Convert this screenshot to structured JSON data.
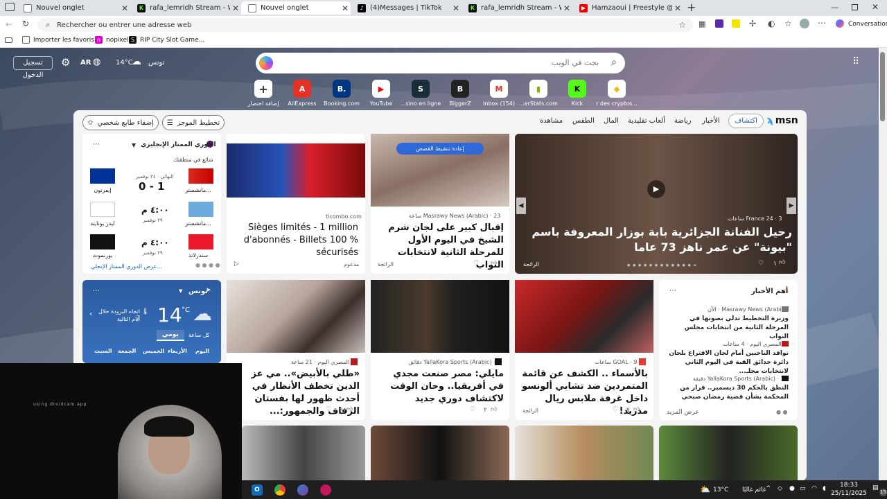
{
  "tabs": [
    {
      "title": "Nouvel onglet",
      "icon": "page-icon",
      "close": "✕"
    },
    {
      "title": "rafa_lemridh Stream - Watch Live",
      "icon": "kick-icon",
      "close": "✕"
    },
    {
      "title": "Nouvel onglet",
      "icon": "page-icon",
      "close": "✕"
    },
    {
      "title": "(4)Messages | TikTok",
      "icon": "tiktok-icon",
      "close": "✕"
    },
    {
      "title": "rafa_lemridh Stream - Watch Live",
      "icon": "kick-icon",
      "close": "✕"
    },
    {
      "title": "Hamzaoui | Freestyle @Rachma R",
      "icon": "youtube-icon",
      "close": "✕"
    }
  ],
  "new_tab": "+",
  "address": {
    "placeholder": "Rechercher ou entrer une adresse web"
  },
  "conversation": "Conversation",
  "favorites": [
    {
      "label": "Importer les favoris"
    },
    {
      "label": "nopixel"
    },
    {
      "label": "RIP City Slot Game..."
    }
  ],
  "msn_top": {
    "signin": "تسجيل الدخول",
    "lang": "AR",
    "temp": "14°C",
    "city": "تونس"
  },
  "search": {
    "placeholder": "بحث في الويب"
  },
  "shortcuts": [
    {
      "label": "إضافة اختصار",
      "glyph": "+"
    },
    {
      "label": "AliExpress",
      "glyph": "A"
    },
    {
      "label": "Booking.com",
      "glyph": "B."
    },
    {
      "label": "YouTube",
      "glyph": "▶"
    },
    {
      "label": "...sino en ligne",
      "glyph": "S"
    },
    {
      "label": "BiggerZ",
      "glyph": "B"
    },
    {
      "label": "Inbox (154)",
      "glyph": "M"
    },
    {
      "label": "...erStats.com",
      "glyph": "▮"
    },
    {
      "label": "Kick",
      "glyph": "K"
    },
    {
      "label": "r des cryptos...",
      "glyph": "◆"
    }
  ],
  "feed_nav": {
    "brand": "msn",
    "items": [
      "اكتشاف",
      "الأخبار",
      "رياضة",
      "ألعاب تقليدية",
      "المال",
      "الطقس",
      "مشاهدة"
    ],
    "personalize": "إضفاء طابع شخصي",
    "layout": "تخطيط الموجز"
  },
  "sports": {
    "league": "الدوري الممتاز الإنجليزي",
    "trending": "شائع في منطقتك",
    "matches": [
      {
        "home": "مانشستر...",
        "away": "إيفرتون",
        "score": "0 - 1",
        "status": "النهائي · ٢٤ نوفمبر"
      },
      {
        "home": "مانشستر...",
        "away": "ليدز يونايتد",
        "score": "٤:٠٠ م",
        "status": "٢٩ نوفمبر"
      },
      {
        "home": "سندرلاند",
        "away": "بورنموث",
        "score": "٤:٠٠ م",
        "status": "٢٩ نوفمبر"
      }
    ],
    "footer": "عرض الدوري الممتاز الإنجلي...",
    "more": "..."
  },
  "cards": {
    "ad": {
      "source": "ticombo.com",
      "title": "Sièges limités - 1 million d'abonnés - Billets 100 % sécurisés",
      "sponsored": "مدعوم"
    },
    "masrawy1": {
      "badge": "إعادة تنشيط القصص",
      "source": "Masrawy News (Arabic) · 23 ساعة",
      "title": "إقبال كبير على لجان شرم الشيخ في اليوم الأول للمرحلة الثانية لانتخابات النواب",
      "follow": "الرائجة"
    },
    "hero": {
      "source": "France 24 · 3 ساعات",
      "title": "رحيل الفنانة الجزائرية بابة بوزار المعروفة باسم \"بيونة\" عن عمر ناهز 73 عاما",
      "follow": "الرائجة",
      "likes": "١"
    },
    "masry": {
      "source": "المصري اليوم · 21 ساعة",
      "title": "«طلي بالأبيض».. مي عز الدين تخطف الأنظار في أحدث ظهور لها بفستان الزفاف والجمهور:...",
      "likes": "٩"
    },
    "yallakora": {
      "source": "YallaKora Sports (Arabic) · 3 دقائق",
      "title": "مايلي: مصر صنعت مجدي في أفريقيا.. وحان الوقت لاكتشاف دوري جديد",
      "likes": "٢"
    },
    "goal": {
      "source": "GOAL · 9 ساعات",
      "title": "بالأسماء .. الكشف عن قائمة المتمردين ضد تشابي ألونسو داخل غرفة ملابس ريال مدريد!",
      "follow": "الرائجة",
      "likes": "٧"
    }
  },
  "top_news": {
    "header": "أهم الأخبار",
    "items": [
      {
        "source": "Masrawy News (Arabic) · الآن",
        "title": "وزيرة التخطيط تدلي بصوتها في المرحلة الثانية من انتخابات مجلس النواب"
      },
      {
        "source": "المصري اليوم · 4 ساعات",
        "title": "توافد الناخبين أمام لجان الاقتراع بلجان دائرة حدائق القبة في اليوم الثاني لانتخابات مجلـ..."
      },
      {
        "source": "YallaKora Sports (Arabic) · 15 دقيقة",
        "title": "النطق بالحكم 30 ديسمبر.. قرار من المحكمة بشأن قضية رمضان صبحي"
      }
    ],
    "more": "عرض المزيد"
  },
  "weather": {
    "city": "تونس",
    "temp": "14",
    "unit": "°C",
    "wind": "اتجاه البرودة خلال 2",
    "days_label": "أيام التالية",
    "tab_hourly": "كل ساعة",
    "tab_daily": "يومي",
    "days": [
      "اليوم",
      "الأربعاء",
      "الخميس",
      "الجمعة",
      "السبت"
    ]
  },
  "webcam": {
    "watermark": "using droidcam.app"
  },
  "taskbar": {
    "temp": "13°C",
    "weather_text": "غائم غالبًا",
    "time": "18:33",
    "date": "25/11/2025",
    "notif": "15"
  }
}
